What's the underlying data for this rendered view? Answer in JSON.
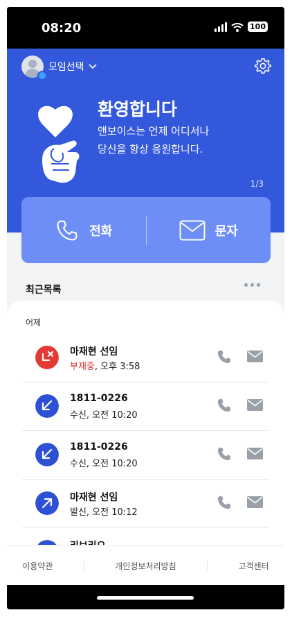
{
  "status_bar": {
    "time": "08:20",
    "battery": "100"
  },
  "header": {
    "group_select": "모임선택"
  },
  "banner": {
    "title": "환영합니다",
    "subtitle_line1": "앤보이스는 언제 어디서나",
    "subtitle_line2": "당신을 항상 응원합니다.",
    "page_indicator": "1/3"
  },
  "actions": {
    "call_label": "전화",
    "message_label": "문자"
  },
  "recent": {
    "title": "최근목록",
    "day_label": "어제",
    "items": [
      {
        "name": "마재현 선임",
        "status": "부재중",
        "time": ", 오후 3:58",
        "type": "missed"
      },
      {
        "name": "1811-0226",
        "status": "수신",
        "time": ", 오전 10:20",
        "type": "incoming"
      },
      {
        "name": "1811-0226",
        "status": "수신",
        "time": ", 오전 10:20",
        "type": "incoming"
      },
      {
        "name": "마재현 선임",
        "status": "발신",
        "time": ", 오전 10:12",
        "type": "outgoing"
      },
      {
        "name": "리브리오",
        "status": "",
        "time": "",
        "type": "incoming"
      }
    ]
  },
  "footer": {
    "terms": "이용약관",
    "privacy": "개인정보처리방침",
    "support": "고객센터"
  },
  "colors": {
    "brand_blue": "#3458dc",
    "card_blue": "#6d8ef6",
    "missed_red": "#e53935",
    "call_blue": "#2e50d4"
  }
}
